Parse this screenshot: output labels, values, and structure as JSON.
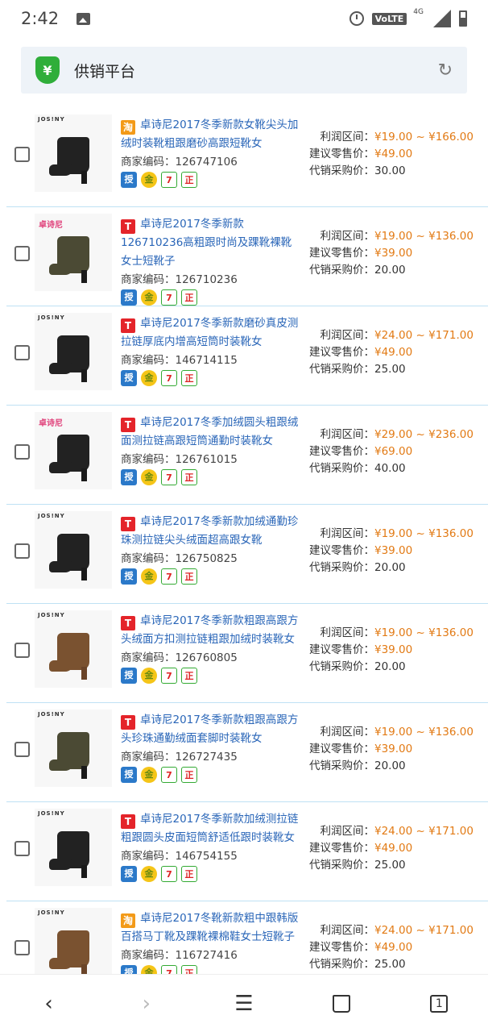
{
  "status_bar": {
    "time": "2:42",
    "network_label": "VoLTE",
    "signal_label": "4G"
  },
  "header": {
    "title": "供销平台",
    "refresh_icon": "refresh-icon",
    "logo_symbol": "¥"
  },
  "products": [
    {
      "shop": "taobao",
      "shop_glyph": "淘",
      "title": "卓诗尼2017冬季新款女靴尖头加绒时装靴粗跟磨砂高跟短靴女",
      "merchant_code": "商家编码：126747106",
      "profit_label": "利润区间：",
      "profit_range": "¥19.00 ~ ¥166.00",
      "retail_label": "建议零售价：",
      "retail_price": "¥49.00",
      "purchase_label": "代销采购价：",
      "purchase_price": "30.00"
    },
    {
      "shop": "tmall",
      "shop_glyph": "T",
      "title": "卓诗尼2017冬季新款126710236高粗跟时尚及踝靴裸靴女士短靴子",
      "merchant_code": "商家编码：126710236",
      "profit_label": "利润区间：",
      "profit_range": "¥19.00 ~ ¥136.00",
      "retail_label": "建议零售价：",
      "retail_price": "¥39.00",
      "purchase_label": "代销采购价：",
      "purchase_price": "20.00"
    },
    {
      "shop": "tmall",
      "shop_glyph": "T",
      "title": "卓诗尼2017冬季新款磨砂真皮测拉链厚底内增高短筒时装靴女",
      "merchant_code": "商家编码：146714115",
      "profit_label": "利润区间：",
      "profit_range": "¥24.00 ~ ¥171.00",
      "retail_label": "建议零售价：",
      "retail_price": "¥49.00",
      "purchase_label": "代销采购价：",
      "purchase_price": "25.00"
    },
    {
      "shop": "tmall",
      "shop_glyph": "T",
      "title": "卓诗尼2017冬季加绒圆头粗跟绒面测拉链高跟短筒通勤时装靴女",
      "merchant_code": "商家编码：126761015",
      "profit_label": "利润区间：",
      "profit_range": "¥29.00 ~ ¥236.00",
      "retail_label": "建议零售价：",
      "retail_price": "¥69.00",
      "purchase_label": "代销采购价：",
      "purchase_price": "40.00"
    },
    {
      "shop": "tmall",
      "shop_glyph": "T",
      "title": "卓诗尼2017冬季新款加绒通勤珍珠测拉链尖头绒面超高跟女靴",
      "merchant_code": "商家编码：126750825",
      "profit_label": "利润区间：",
      "profit_range": "¥19.00 ~ ¥136.00",
      "retail_label": "建议零售价：",
      "retail_price": "¥39.00",
      "purchase_label": "代销采购价：",
      "purchase_price": "20.00"
    },
    {
      "shop": "tmall",
      "shop_glyph": "T",
      "title": "卓诗尼2017冬季新款粗跟高跟方头绒面方扣测拉链粗跟加绒时装靴女",
      "merchant_code": "商家编码：126760805",
      "profit_label": "利润区间：",
      "profit_range": "¥19.00 ~ ¥136.00",
      "retail_label": "建议零售价：",
      "retail_price": "¥39.00",
      "purchase_label": "代销采购价：",
      "purchase_price": "20.00"
    },
    {
      "shop": "tmall",
      "shop_glyph": "T",
      "title": "卓诗尼2017冬季新款粗跟高跟方头珍珠通勤绒面套脚时装靴女",
      "merchant_code": "商家编码：126727435",
      "profit_label": "利润区间：",
      "profit_range": "¥19.00 ~ ¥136.00",
      "retail_label": "建议零售价：",
      "retail_price": "¥39.00",
      "purchase_label": "代销采购价：",
      "purchase_price": "20.00"
    },
    {
      "shop": "tmall",
      "shop_glyph": "T",
      "title": "卓诗尼2017冬季新款加绒测拉链粗跟圆头皮面短筒舒适低跟时装靴女",
      "merchant_code": "商家编码：146754155",
      "profit_label": "利润区间：",
      "profit_range": "¥24.00 ~ ¥171.00",
      "retail_label": "建议零售价：",
      "retail_price": "¥49.00",
      "purchase_label": "代销采购价：",
      "purchase_price": "25.00"
    },
    {
      "shop": "taobao",
      "shop_glyph": "淘",
      "title": "卓诗尼2017冬靴新款粗中跟韩版百搭马丁靴及踝靴裸棉鞋女士短靴子",
      "merchant_code": "商家编码：116727416",
      "profit_label": "利润区间：",
      "profit_range": "¥24.00 ~ ¥171.00",
      "retail_label": "建议零售价：",
      "retail_price": "¥49.00",
      "purchase_label": "代销采购价：",
      "purchase_price": "25.00"
    }
  ],
  "thumb_brand": "JOS!NY",
  "badges": [
    "授",
    "金",
    "7",
    "正"
  ],
  "bottom_nav": {
    "tab_count": "1"
  },
  "colors": {
    "link": "#2a66b8",
    "price": "#e27a14",
    "divider": "#bfe1f4",
    "tmall": "#e4242a",
    "taobao": "#f39a18"
  }
}
